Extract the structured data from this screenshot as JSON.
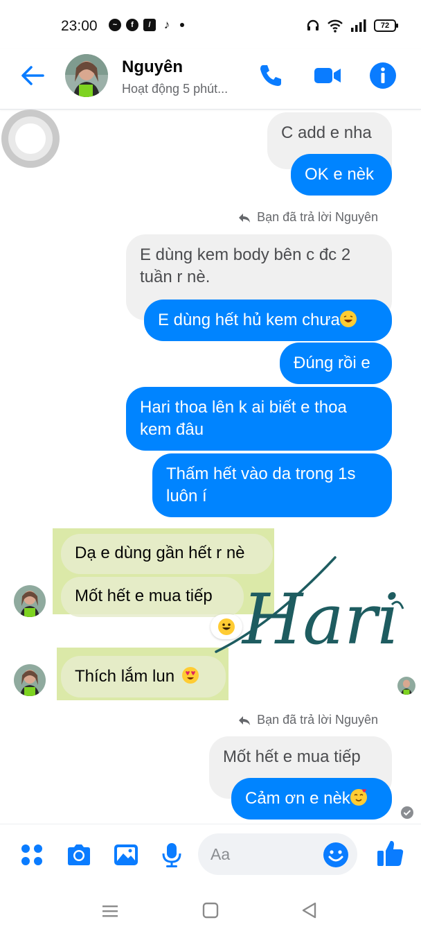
{
  "status_bar": {
    "time": "23:00",
    "battery": "72",
    "left_icons": [
      "messenger-icon",
      "facebook-icon",
      "app-icon",
      "tiktok-icon",
      "dot-icon"
    ],
    "right_icons": [
      "headset-icon",
      "wifi-icon",
      "signal-icon",
      "battery-icon"
    ]
  },
  "header": {
    "name": "Nguyên",
    "status": "Hoạt động 5 phút...",
    "actions": [
      "phone-icon",
      "video-icon",
      "info-icon"
    ]
  },
  "messages": {
    "m1": "C add e nha",
    "m2": "OK e nèk",
    "reply_note_1": "Bạn đã trả lời Nguyên",
    "quoted_1": "E dùng kem body bên c đc 2 tuần r nè.",
    "m3": "E dùng hết hủ kem chưa",
    "m4": "Đúng rồi e",
    "m5": "Hari thoa lên k ai biết e thoa kem đâu",
    "m6": "Thấm hết vào da trong 1s luôn í",
    "t1": "Dạ e dùng gần hết r nè",
    "t2": "Mốt hết e mua tiếp",
    "t3": "Thích lắm lun",
    "reply_note_2": "Bạn đã trả lời Nguyên",
    "quoted_2": "Mốt hết e mua tiếp",
    "m7": "Cảm ơn e nèk"
  },
  "watermark": "Hari",
  "composer": {
    "placeholder": "Aa",
    "tools": [
      "menu-icon",
      "camera-icon",
      "gallery-icon",
      "mic-icon",
      "emoji-icon",
      "like-icon"
    ]
  },
  "colors": {
    "accent": "#0084ff",
    "watermark": "#1e5c60",
    "highlight": "#c3db6e"
  }
}
